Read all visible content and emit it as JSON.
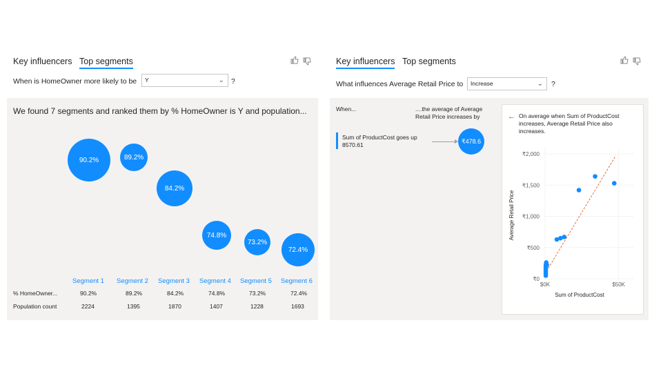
{
  "left": {
    "tabs": [
      "Key influencers",
      "Top segments"
    ],
    "question_prefix": "When is HomeOwner more likely to be",
    "select_value": "Y",
    "question_suffix": "?",
    "headline": "We found 7 segments and ranked them by % HomeOwner is Y and population...",
    "segments": [
      {
        "label": "Segment 1",
        "pct": "90.2%",
        "pop": "2224"
      },
      {
        "label": "Segment 2",
        "pct": "89.2%",
        "pop": "1395"
      },
      {
        "label": "Segment 3",
        "pct": "84.2%",
        "pop": "1870"
      },
      {
        "label": "Segment 4",
        "pct": "74.8%",
        "pop": "1407"
      },
      {
        "label": "Segment 5",
        "pct": "73.2%",
        "pop": "1228"
      },
      {
        "label": "Segment 6",
        "pct": "72.4%",
        "pop": "1693"
      }
    ],
    "row_labels": [
      "% HomeOwner...",
      "Population count"
    ]
  },
  "right": {
    "tabs": [
      "Key influencers",
      "Top segments"
    ],
    "question_prefix": "What influences Average Retail Price to",
    "select_value": "Increase",
    "question_suffix": "?",
    "when_header": "When...",
    "then_header": "....the average of Average Retail Price increases by",
    "influencer": "Sum of ProductCost goes up 8570.61",
    "influencer_value": "₹478.6",
    "detail_text": "On average when Sum of ProductCost increases, Average Retail Price also increases."
  },
  "chart_data": {
    "type": "scatter",
    "xlabel": "Sum of ProductCost",
    "ylabel": "Average Retail Price",
    "x_ticks": [
      "$0K",
      "$50K"
    ],
    "y_ticks": [
      "₹0",
      "₹500",
      "₹1,000",
      "₹1,500",
      "₹2,000"
    ],
    "xlim": [
      0,
      60000
    ],
    "ylim": [
      0,
      2100
    ],
    "points": [
      {
        "x": 500,
        "y": 50
      },
      {
        "x": 500,
        "y": 80
      },
      {
        "x": 500,
        "y": 110
      },
      {
        "x": 500,
        "y": 140
      },
      {
        "x": 500,
        "y": 170
      },
      {
        "x": 500,
        "y": 200
      },
      {
        "x": 600,
        "y": 230
      },
      {
        "x": 800,
        "y": 260
      },
      {
        "x": 1200,
        "y": 220
      },
      {
        "x": 8000,
        "y": 630
      },
      {
        "x": 10500,
        "y": 650
      },
      {
        "x": 13000,
        "y": 670
      },
      {
        "x": 23000,
        "y": 1420
      },
      {
        "x": 34000,
        "y": 1640
      },
      {
        "x": 47000,
        "y": 1530
      }
    ],
    "trendline": [
      {
        "x": 1000,
        "y": 120
      },
      {
        "x": 48000,
        "y": 1970
      }
    ],
    "colors": {
      "points": "#118DFF",
      "trend": "#E66C37"
    }
  }
}
